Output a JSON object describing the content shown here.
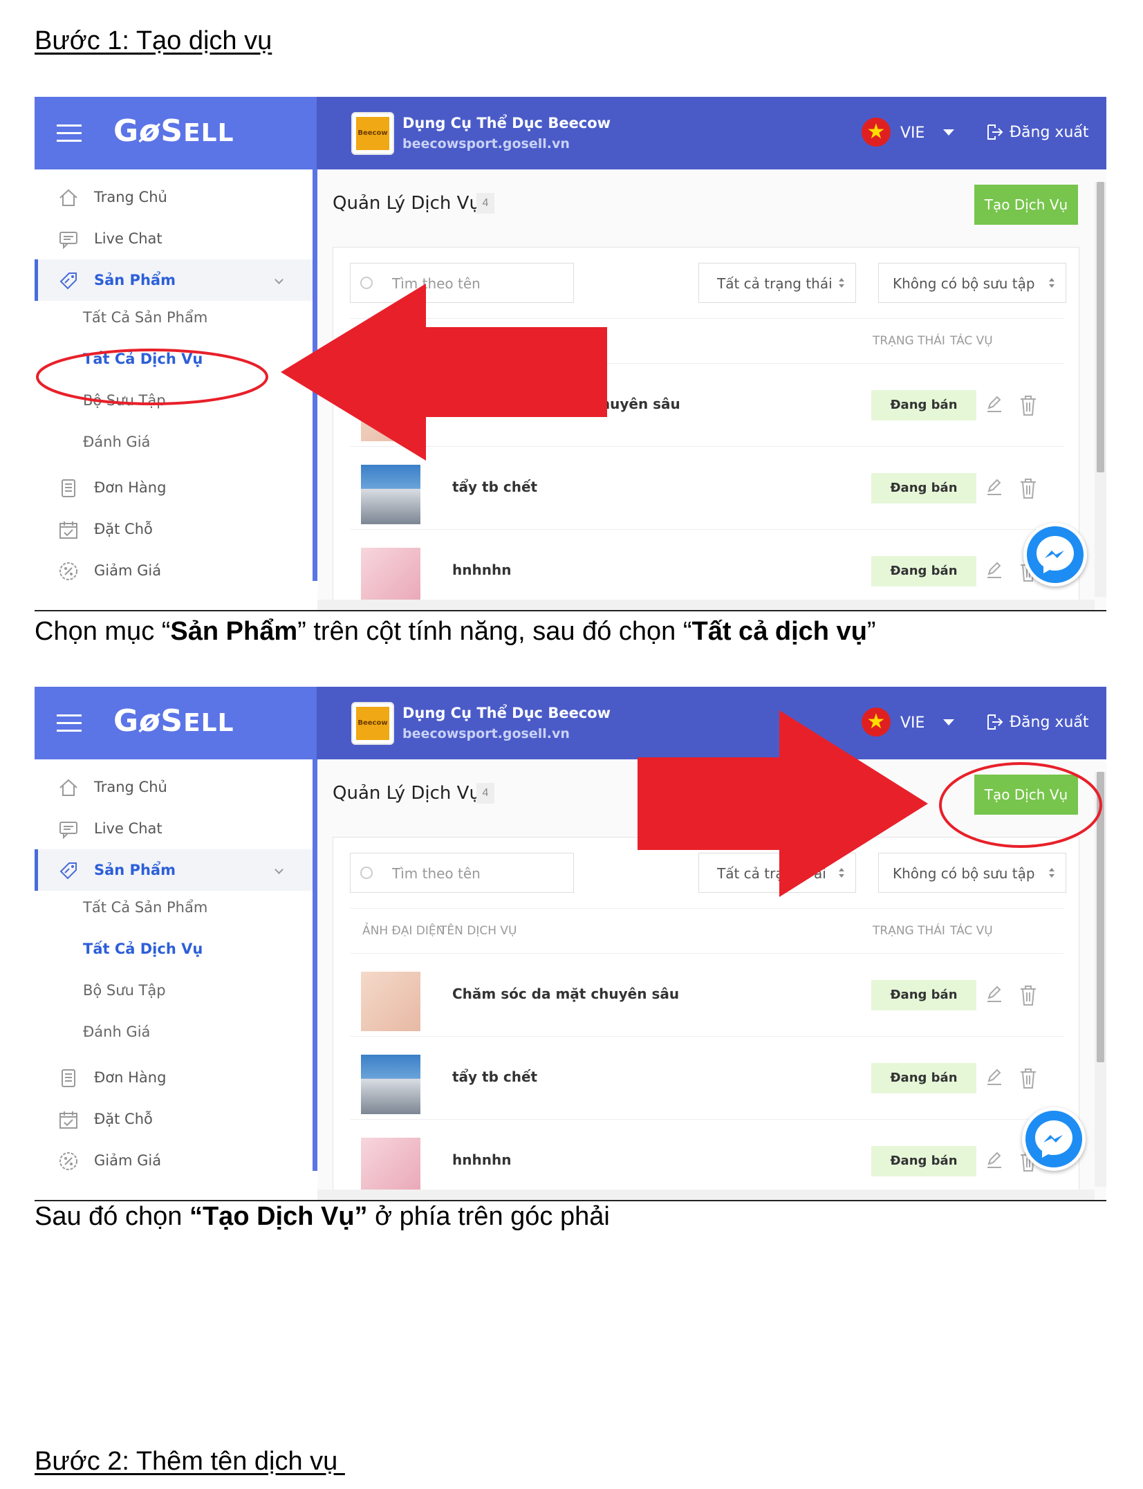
{
  "document": {
    "step1_heading": "Bước 1: Tạo dịch vụ",
    "caption1_pre": "Chọn mục “",
    "caption1_bold1": "Sản Phẩm",
    "caption1_mid": "” trên cột tính năng, sau đó chọn “",
    "caption1_bold2": "Tất cả dịch vụ",
    "caption1_post": "”",
    "caption2_pre": "Sau đó chọn ",
    "caption2_bold": "“Tạo Dịch Vụ”",
    "caption2_post": " ở phía trên góc phải",
    "step2_heading": "Bước 2: Thêm tên dịch vụ "
  },
  "app": {
    "brand": "GoSELL",
    "shop_name": "Dụng Cụ Thể Dục Beecow",
    "shop_url": "beecowsport.gosell.vn",
    "shop_logo_text": "Beecow",
    "language": "VIE",
    "logout_label": "Đăng xuất"
  },
  "sidebar": {
    "items": [
      {
        "label": "Trang Chủ",
        "icon": "home-icon"
      },
      {
        "label": "Live Chat",
        "icon": "chat-icon"
      },
      {
        "label": "Sản Phẩm",
        "icon": "tag-icon"
      },
      {
        "label": "Đơn Hàng",
        "icon": "receipt-icon"
      },
      {
        "label": "Đặt Chỗ",
        "icon": "calendar-check-icon"
      },
      {
        "label": "Giảm Giá",
        "icon": "discount-icon"
      }
    ],
    "sub_items": [
      "Tất Cả Sản Phẩm",
      "Tất Cả Dịch Vụ",
      "Bộ Sưu Tập",
      "Đánh Giá"
    ]
  },
  "main": {
    "title": "Quản Lý Dịch Vụ",
    "count": "4",
    "create_button": "Tạo Dịch Vụ",
    "search_placeholder": "Tìm theo tên",
    "status_filter": "Tất cả trạng thái",
    "collection_filter": "Không có bộ sưu tập",
    "columns": [
      "ẢNH ĐẠI DIỆN",
      "TÊN DỊCH VỤ",
      "TRẠNG THÁI",
      "TÁC VỤ"
    ],
    "rows": [
      {
        "name": "Chăm sóc da mặt chuyên sâu",
        "status": "Đang bán"
      },
      {
        "name": "tẩy tb chết",
        "status": "Đang bán"
      },
      {
        "name": "hnhnhn",
        "status": "Đang bán"
      }
    ],
    "row1_partial_name": "ật chuyên sâu",
    "filter2_partial": "Tất cả trạn",
    "filter2_partial_tail": "ái"
  },
  "colors": {
    "header": "#4a5bc8",
    "brand_box": "#5b74e6",
    "accent_blue": "#2d5fd8",
    "create_green": "#77c54c",
    "status_bg": "#e6f7d8",
    "annotation_red": "#e8202a",
    "messenger": "#1d8df3"
  }
}
